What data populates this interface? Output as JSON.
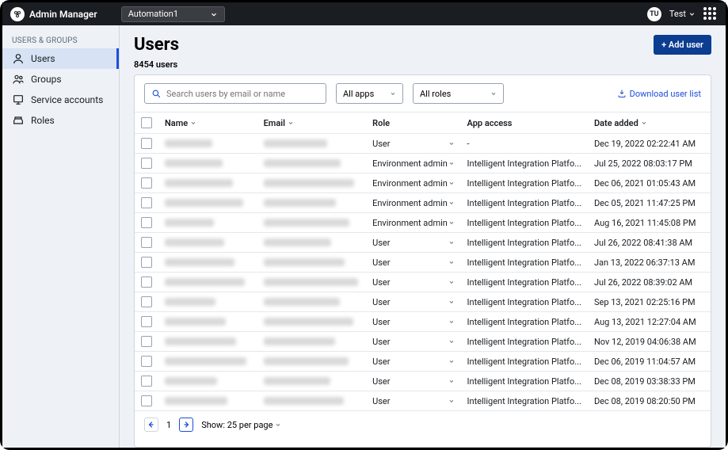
{
  "header": {
    "app_name": "Admin Manager",
    "environment": "Automation1",
    "user_initials": "TU",
    "user_label": "Test"
  },
  "sidebar": {
    "heading": "USERS & GROUPS",
    "items": [
      {
        "label": "Users"
      },
      {
        "label": "Groups"
      },
      {
        "label": "Service accounts"
      },
      {
        "label": "Roles"
      }
    ]
  },
  "main": {
    "title": "Users",
    "add_button": "+ Add user",
    "count_label": "8454 users",
    "search_placeholder": "Search users by email or name",
    "filter_apps": "All apps",
    "filter_roles": "All roles",
    "download_label": "Download user list",
    "columns": {
      "name": "Name",
      "email": "Email",
      "role": "Role",
      "app_access": "App access",
      "date_added": "Date added"
    },
    "rows": [
      {
        "role": "User",
        "access": "-",
        "date": "Dec 19, 2022 02:22:41 AM"
      },
      {
        "role": "Environment admin",
        "access": "Intelligent Integration Platfo...",
        "date": "Jul 25, 2022 08:03:17 PM"
      },
      {
        "role": "Environment admin",
        "access": "Intelligent Integration Platfo...",
        "date": "Dec 06, 2021 01:05:43 AM"
      },
      {
        "role": "Environment admin",
        "access": "Intelligent Integration Platfo...",
        "date": "Dec 05, 2021 11:47:25 PM"
      },
      {
        "role": "Environment admin",
        "access": "Intelligent Integration Platfo...",
        "date": "Aug 16, 2021 11:45:08 PM"
      },
      {
        "role": "User",
        "access": "Intelligent Integration Platfo...",
        "date": "Jul 26, 2022 08:41:38 AM"
      },
      {
        "role": "User",
        "access": "Intelligent Integration Platfo...",
        "date": "Jan 13, 2022 06:37:13 AM"
      },
      {
        "role": "User",
        "access": "Intelligent Integration Platfo...",
        "date": "Jul 26, 2022 08:39:02 AM"
      },
      {
        "role": "User",
        "access": "Intelligent Integration Platfo...",
        "date": "Sep 13, 2021 02:25:16 PM"
      },
      {
        "role": "User",
        "access": "Intelligent Integration Platfo...",
        "date": "Aug 13, 2021 12:27:04 AM"
      },
      {
        "role": "User",
        "access": "Intelligent Integration Platfo...",
        "date": "Nov 12, 2019 04:06:38 AM"
      },
      {
        "role": "User",
        "access": "Intelligent Integration Platfo...",
        "date": "Dec 06, 2019 11:04:57 AM"
      },
      {
        "role": "User",
        "access": "Intelligent Integration Platfo...",
        "date": "Dec 08, 2019 03:38:33 PM"
      },
      {
        "role": "User",
        "access": "Intelligent Integration Platfo...",
        "date": "Dec 08, 2019 08:20:50 PM"
      }
    ],
    "pager": {
      "page": "1",
      "show": "Show: 25 per page"
    }
  }
}
